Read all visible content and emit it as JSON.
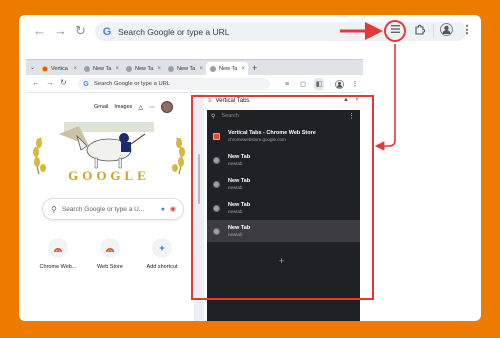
{
  "outer_toolbar": {
    "omnibox_placeholder": "Search Google or type a URL",
    "google_letter": "G"
  },
  "inner_window": {
    "tabs": [
      {
        "label": "Vertica",
        "active": false
      },
      {
        "label": "New Ta",
        "active": false
      },
      {
        "label": "New Ta",
        "active": false
      },
      {
        "label": "New Ta",
        "active": false
      },
      {
        "label": "New Ta",
        "active": true
      }
    ],
    "new_tab_symbol": "+",
    "omnibox_placeholder": "Search Google or type a URL"
  },
  "new_tab_page": {
    "links": [
      "Gmail",
      "Images"
    ],
    "search_placeholder": "Search Google or type a U...",
    "shortcuts": [
      {
        "label": "Chrome Web...",
        "icon": "chrome-webstore-icon"
      },
      {
        "label": "Web Store",
        "icon": "chrome-webstore-icon"
      },
      {
        "label": "Add shortcut",
        "icon": "plus-icon",
        "symbol": "+"
      }
    ]
  },
  "side_panel": {
    "title": "Vertical Tabs",
    "search_placeholder": "Search",
    "tabs": [
      {
        "title": "Vertical Tabs - Chrome Web Store",
        "url": "chromewebstore.google.com",
        "selected": false
      },
      {
        "title": "New Tab",
        "url": "newtab",
        "selected": false
      },
      {
        "title": "New Tab",
        "url": "newtab",
        "selected": false
      },
      {
        "title": "New Tab",
        "url": "newtab",
        "selected": false
      },
      {
        "title": "New Tab",
        "url": "newtab",
        "selected": true
      }
    ],
    "add_symbol": "+"
  },
  "colors": {
    "background": "#ec7b00",
    "highlight": "#e53935",
    "panel_dark": "#202124"
  }
}
